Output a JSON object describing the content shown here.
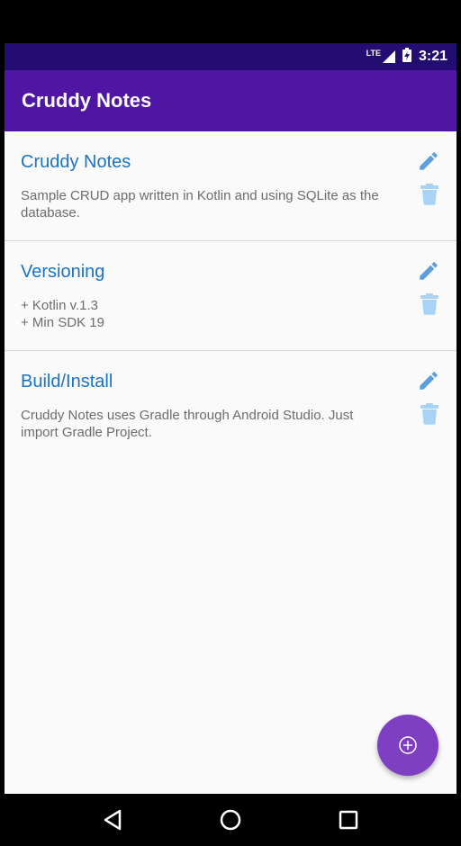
{
  "status_bar": {
    "network": "LTE",
    "time": "3:21"
  },
  "app_bar": {
    "title": "Cruddy Notes"
  },
  "notes": [
    {
      "title": "Cruddy Notes",
      "body": "Sample CRUD app written in Kotlin and using SQLite as the database."
    },
    {
      "title": "Versioning",
      "body": "+ Kotlin v.1.3\n+ Min SDK 19"
    },
    {
      "title": "Build/Install",
      "body": "Cruddy Notes uses Gradle through Android Studio. Just import Gradle Project."
    }
  ],
  "colors": {
    "status_bar": "#230d72",
    "app_bar": "#4e16a3",
    "note_title": "#1a73c4",
    "action_icon": "#5c9fdc",
    "fab": "#7e3fc2"
  },
  "icons": {
    "edit": "pencil-icon",
    "delete": "trash-icon",
    "fab": "plus-circle-icon",
    "nav_back": "back-triangle-icon",
    "nav_home": "home-circle-icon",
    "nav_recents": "recents-square-icon"
  }
}
